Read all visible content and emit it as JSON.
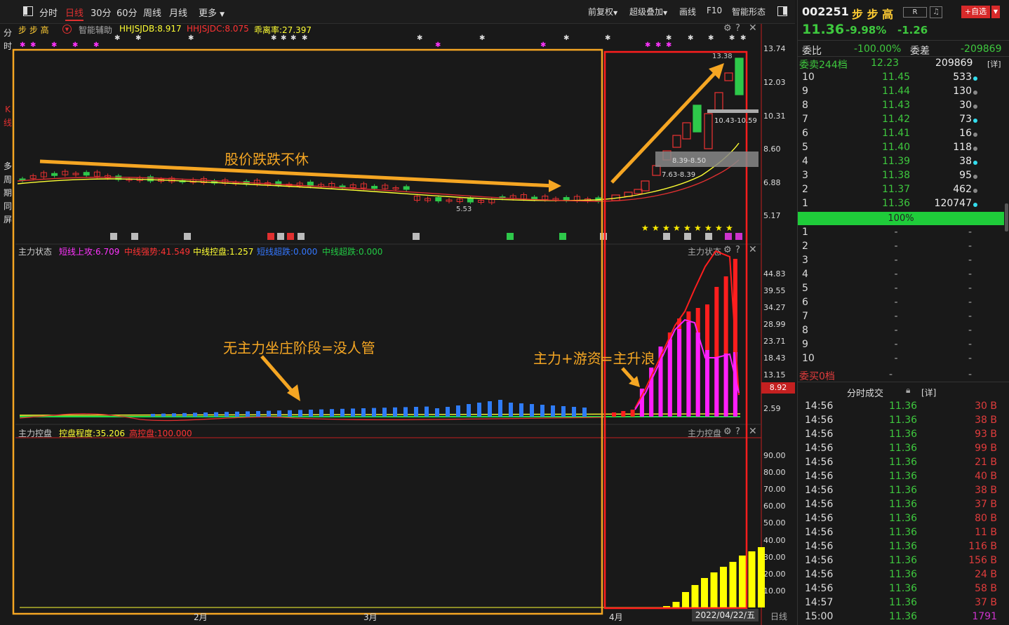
{
  "toolbar": {
    "tabs": [
      "分时",
      "日线",
      "30分",
      "60分",
      "周线",
      "月线"
    ],
    "more": "更多",
    "right": [
      "前复权",
      "超级叠加",
      "画线",
      "F10",
      "智能形态"
    ]
  },
  "left_strip": {
    "fenshi": [
      "分",
      "时"
    ],
    "kline": [
      "K",
      "线"
    ],
    "multi": [
      "多",
      "周",
      "期",
      "同",
      "屏"
    ]
  },
  "chart1": {
    "name": "步 步 高",
    "assist": "智能辅助",
    "ind": [
      "HHJSJDB:8.917",
      "HHJSJDC:8.075",
      "乖离率:27.397"
    ],
    "axis": [
      "13.74",
      "12.03",
      "10.31",
      "8.60",
      "6.88",
      "5.17"
    ],
    "labels": {
      "top": "13.38",
      "band1": "10.43-10.59",
      "band2": "8.39-8.50",
      "band3": "7.63-8.39",
      "low": "5.53"
    },
    "annotation": "股价跌跌不休"
  },
  "chart2": {
    "title": "主力状态",
    "ind": [
      "短线上攻:6.709",
      "中线强势:41.549",
      "中线控盘:1.257",
      "短线超跌:0.000",
      "中线超跌:0.000"
    ],
    "name_r": "主力状态",
    "axis": [
      "44.83",
      "39.55",
      "34.27",
      "28.99",
      "23.71",
      "18.43",
      "13.15",
      "2.59"
    ],
    "cur": "8.92",
    "annot1": "无主力坐庄阶段=没人管",
    "annot2": "主力+游资=主升浪"
  },
  "chart3": {
    "title": "主力控盘",
    "ind": [
      "控盘程度:35.206",
      "高控盘:100.000"
    ],
    "name_r": "主力控盘",
    "axis": [
      "90.00",
      "80.00",
      "70.00",
      "60.00",
      "50.00",
      "40.00",
      "30.00",
      "20.00",
      "10.00"
    ]
  },
  "xaxis": {
    "labels": [
      "2月",
      "3月",
      "4月"
    ],
    "date": "2022/04/22/五",
    "period": "日线"
  },
  "stock": {
    "code": "002251",
    "name": "步 步 高",
    "r": "R",
    "add": "+自选",
    "price": "11.36",
    "pct": "-9.98%",
    "chg": "-1.26"
  },
  "book": {
    "wb_label": "委比",
    "wb": "-100.00%",
    "wc_label": "委差",
    "wc": "-209869",
    "sell_hdr": "委卖244档",
    "sell_hdr_price": "12.23",
    "sell_hdr_vol": "209869",
    "detail": "[详]",
    "sells": [
      [
        "10",
        "11.45",
        "533"
      ],
      [
        "9",
        "11.44",
        "130"
      ],
      [
        "8",
        "11.43",
        "30"
      ],
      [
        "7",
        "11.42",
        "73"
      ],
      [
        "6",
        "11.41",
        "16"
      ],
      [
        "5",
        "11.40",
        "118"
      ],
      [
        "4",
        "11.39",
        "38"
      ],
      [
        "3",
        "11.38",
        "95"
      ],
      [
        "2",
        "11.37",
        "462"
      ],
      [
        "1",
        "11.36",
        "120747"
      ]
    ],
    "bar": "100%",
    "buys": [
      [
        "1",
        "-",
        "-"
      ],
      [
        "2",
        "-",
        "-"
      ],
      [
        "3",
        "-",
        "-"
      ],
      [
        "4",
        "-",
        "-"
      ],
      [
        "5",
        "-",
        "-"
      ],
      [
        "6",
        "-",
        "-"
      ],
      [
        "7",
        "-",
        "-"
      ],
      [
        "8",
        "-",
        "-"
      ],
      [
        "9",
        "-",
        "-"
      ],
      [
        "10",
        "-",
        "-"
      ]
    ],
    "buy_hdr": "委买0档",
    "buy_hdr_price": "-",
    "buy_hdr_vol": "-"
  },
  "trades": {
    "title": "分时成交",
    "detail": "[详]",
    "rows": [
      [
        "14:56",
        "11.36",
        "30 B"
      ],
      [
        "14:56",
        "11.36",
        "38 B"
      ],
      [
        "14:56",
        "11.36",
        "93 B"
      ],
      [
        "14:56",
        "11.36",
        "99 B"
      ],
      [
        "14:56",
        "11.36",
        "21 B"
      ],
      [
        "14:56",
        "11.36",
        "40 B"
      ],
      [
        "14:56",
        "11.36",
        "38 B"
      ],
      [
        "14:56",
        "11.36",
        "37 B"
      ],
      [
        "14:56",
        "11.36",
        "80 B"
      ],
      [
        "14:56",
        "11.36",
        "11 B"
      ],
      [
        "14:56",
        "11.36",
        "116 B"
      ],
      [
        "14:56",
        "11.36",
        "156 B"
      ],
      [
        "14:56",
        "11.36",
        "24 B"
      ],
      [
        "14:56",
        "11.36",
        "58 B"
      ],
      [
        "14:57",
        "11.36",
        "37 B"
      ],
      [
        "15:00",
        "11.36",
        "1791"
      ]
    ]
  },
  "colors": {
    "up": "#e03030",
    "down": "#2ec84a",
    "accent": "#f5a623",
    "blue": "#2f7cf6",
    "magenta": "#ff1fff",
    "yellow": "#ffff00"
  }
}
